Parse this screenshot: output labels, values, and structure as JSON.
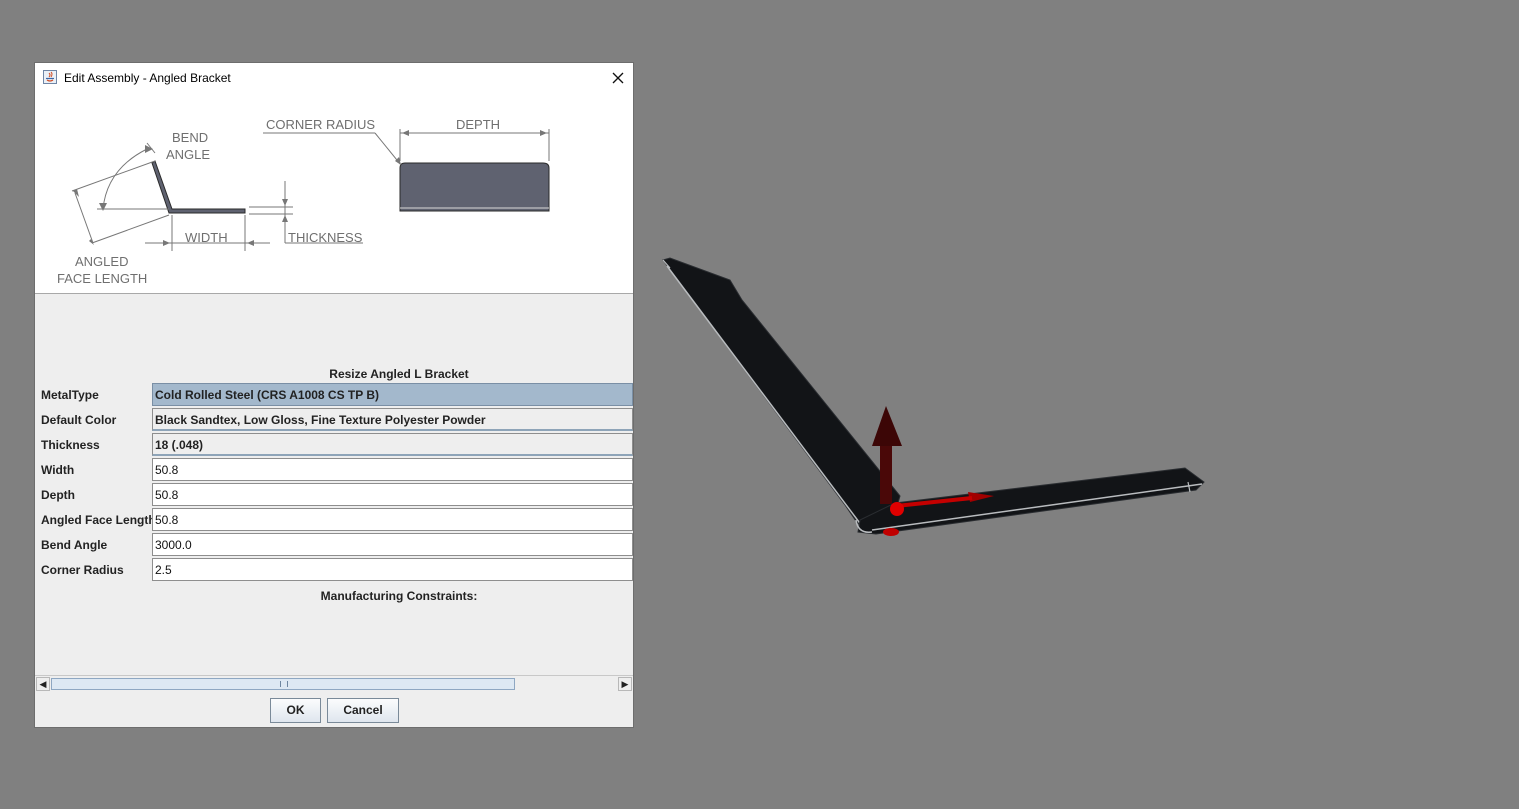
{
  "window": {
    "title": "Edit Assembly - Angled Bracket"
  },
  "diagram": {
    "bend_angle": [
      "BEND",
      "ANGLE"
    ],
    "corner_radius": "CORNER RADIUS",
    "depth": "DEPTH",
    "width": "WIDTH",
    "thickness": "THICKNESS",
    "angled_face_length": [
      "ANGLED",
      "FACE LENGTH"
    ]
  },
  "form": {
    "heading": "Resize Angled L Bracket",
    "fields": [
      {
        "label": "MetalType",
        "value": "Cold Rolled Steel (CRS A1008 CS TP B)"
      },
      {
        "label": "Default Color",
        "value": "Black Sandtex, Low Gloss, Fine Texture Polyester Powder"
      },
      {
        "label": "Thickness",
        "value": "18 (.048)"
      },
      {
        "label": "Width",
        "value": "50.8"
      },
      {
        "label": "Depth",
        "value": "50.8"
      },
      {
        "label": "Angled Face Length",
        "value": "50.8"
      },
      {
        "label": "Bend Angle",
        "value": "3000.0"
      },
      {
        "label": "Corner Radius",
        "value": "2.5"
      }
    ],
    "constraints_heading": "Manufacturing Constraints:"
  },
  "scrollbar": {
    "left_arrow": "◀",
    "right_arrow": "▶"
  },
  "buttons": {
    "ok": "OK",
    "cancel": "Cancel"
  },
  "colors": {
    "viewport_background": "#808080",
    "bracket_fill": "#121417",
    "gizmo_red": "#d10000",
    "gizmo_dark_red": "#4a0808",
    "selected_combo": "#a3b8cc"
  }
}
